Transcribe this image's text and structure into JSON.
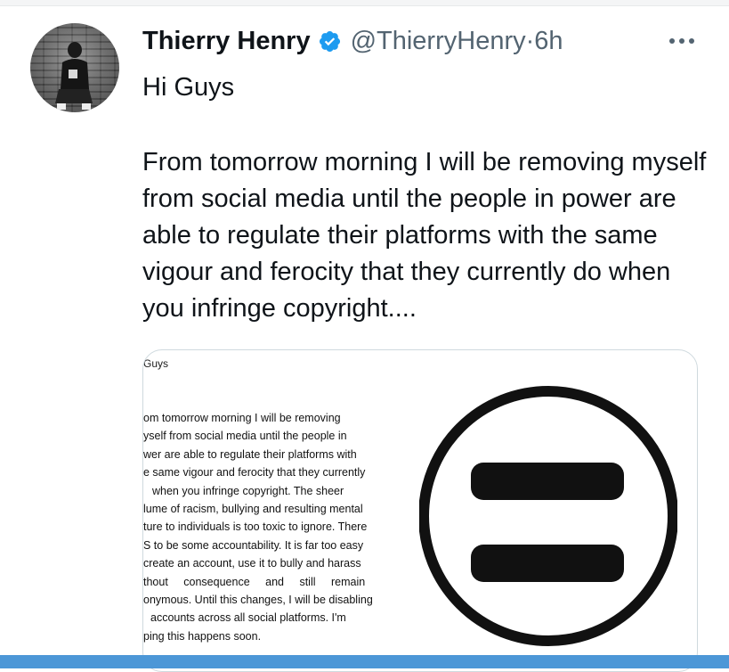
{
  "tweet": {
    "display_name": "Thierry Henry",
    "handle": "@ThierryHenry",
    "separator": " · ",
    "time": "6h",
    "verified": true,
    "greeting": "Hi Guys",
    "body": "From tomorrow morning I will be removing myself from social media until the people in power are able to regulate their platforms with the same vigour and ferocity that they currently do when you infringe copyright....",
    "icons": {
      "avatar": "profile-photo",
      "verified": "verified-badge-icon",
      "more": "more-options-icon"
    },
    "accent_color": "#1d9bf0"
  },
  "media": {
    "doc_title": "Guys",
    "doc_lines": [
      "om tomorrow morning I will be removing",
      "yself from social media until the people in",
      "wer are able to regulate their platforms with",
      "e same vigour and ferocity that they currently",
      "when you infringe copyright. The sheer",
      "lume of racism, bullying and resulting mental",
      "ture to individuals is too toxic to ignore. There",
      "S to be some accountability. It is far too easy",
      "create an account, use it to bully and harass",
      "thout consequence and still remain",
      "onymous. Until this changes, I will be disabling",
      "accounts across all social platforms. I'm",
      "ping this happens soon."
    ],
    "logo_icon": "equality-symbol-icon"
  }
}
